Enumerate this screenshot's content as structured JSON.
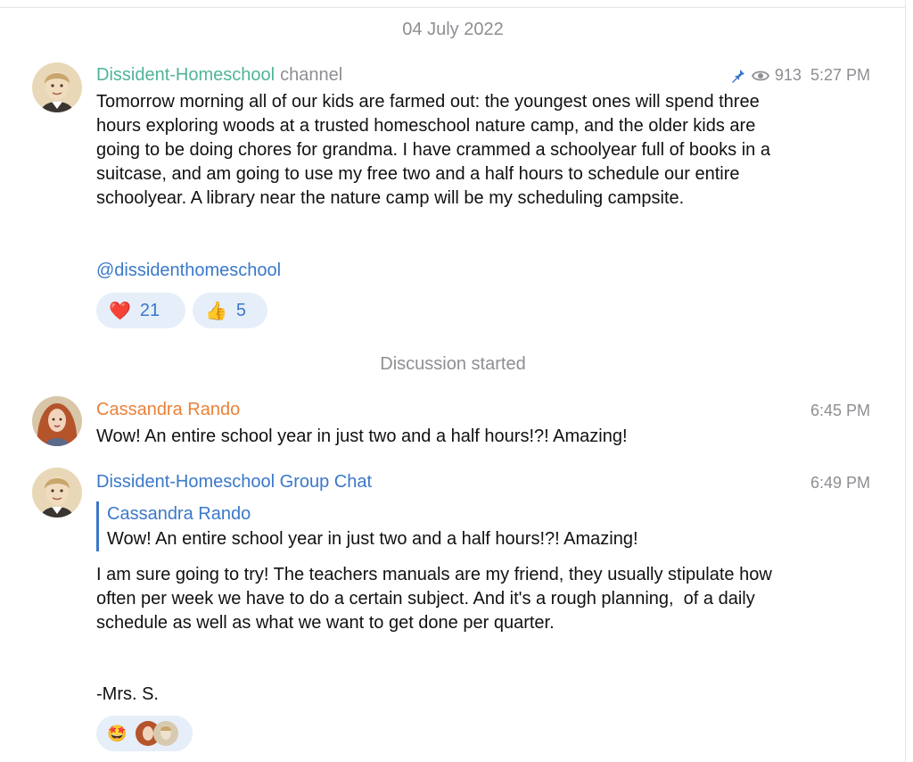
{
  "date_separator": "04 July 2022",
  "service_message": "Discussion started",
  "channel_post": {
    "author": "Dissident-Homeschool",
    "author_suffix": "channel",
    "views": "913",
    "time": "5:27 PM",
    "text": "Tomorrow morning all of our kids are farmed out: the youngest ones will spend three hours exploring woods at a trusted homeschool nature camp, and the older kids are going to be doing chores for grandma. I have crammed a schoolyear full of books in a suitcase, and am going to use my free two and a half hours to schedule our entire schoolyear. A library near the nature camp will be my scheduling campsite.",
    "link": "@dissidenthomeschool",
    "reactions": [
      {
        "emoji": "❤️",
        "count": "21"
      },
      {
        "emoji": "👍",
        "count": "5"
      }
    ]
  },
  "comment": {
    "author": "Cassandra Rando",
    "time": "6:45 PM",
    "text": "Wow! An entire school year in just two and a half hours!?! Amazing!"
  },
  "reply": {
    "author": "Dissident-Homeschool Group Chat",
    "time": "6:49 PM",
    "quote_author": "Cassandra Rando",
    "quote_text": "Wow! An entire school year in just two and a half hours!?! Amazing!",
    "text": "I am sure going to try! The teachers manuals are my friend, they usually stipulate how often per week we have to do a certain subject. And it's a rough planning,  of a daily schedule as well as what we want to get done per quarter.",
    "signature": "-Mrs. S.",
    "reaction_emoji": "🤩"
  },
  "colors": {
    "channel_name": "#4fb49a",
    "comment_name": "#e9823a",
    "group_name": "#3a78c9",
    "link": "#3a78c9",
    "reaction_bg": "#e6eef9",
    "meta_gray": "#8e8e93"
  }
}
